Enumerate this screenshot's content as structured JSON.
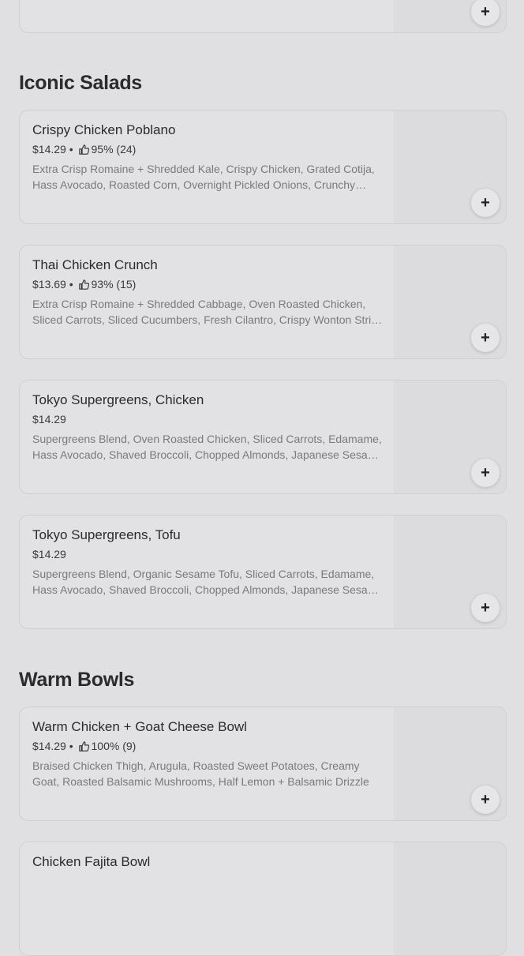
{
  "sections": [
    {
      "title": "Iconic Salads",
      "items": [
        {
          "name": "Crispy Chicken Poblano",
          "price": "$14.29",
          "rating": "95% (24)",
          "description": "Extra Crisp Romaine + Shredded Kale, Crispy Chicken, Grated Cotija, Hass Avocado, Roasted Corn, Overnight Pickled Onions, Crunchy Tortilla Strips, Lime Squeeze + Lime Cilantro Jalapeño Vinaigrette"
        },
        {
          "name": "Thai Chicken Crunch",
          "price": "$13.69",
          "rating": "93% (15)",
          "description": "Extra Crisp Romaine + Shredded Cabbage, Oven Roasted Chicken, Sliced Carrots, Sliced Cucumbers, Fresh Cilantro, Crispy Wonton Strips + Spicy Peanut Dressing"
        },
        {
          "name": "Tokyo Supergreens, Chicken",
          "price": "$14.29",
          "rating": "",
          "description": "Supergreens Blend, Oven Roasted Chicken, Sliced Carrots, Edamame, Hass Avocado, Shaved Broccoli, Chopped Almonds, Japanese Sesame Vinaigrette"
        },
        {
          "name": "Tokyo Supergreens, Tofu",
          "price": "$14.29",
          "rating": "",
          "description": "Supergreens Blend, Organic Sesame Tofu, Sliced Carrots, Edamame, Hass Avocado, Shaved Broccoli, Chopped Almonds, Japanese Sesame Vinaigrette"
        }
      ]
    },
    {
      "title": "Warm Bowls",
      "items": [
        {
          "name": "Warm Chicken + Goat Cheese Bowl",
          "price": "$14.29",
          "rating": "100% (9)",
          "description": "Braised Chicken Thigh, Arugula, Roasted Sweet Potatoes, Creamy Goat, Roasted Balsamic Mushrooms, Half Lemon + Balsamic Drizzle"
        },
        {
          "name": "Chicken Fajita Bowl",
          "price": "",
          "rating": "",
          "description": ""
        }
      ]
    }
  ],
  "add_glyph": "+",
  "separator": " • ",
  "icons": {
    "add": "plus-icon",
    "rating": "thumbs-up-icon"
  }
}
